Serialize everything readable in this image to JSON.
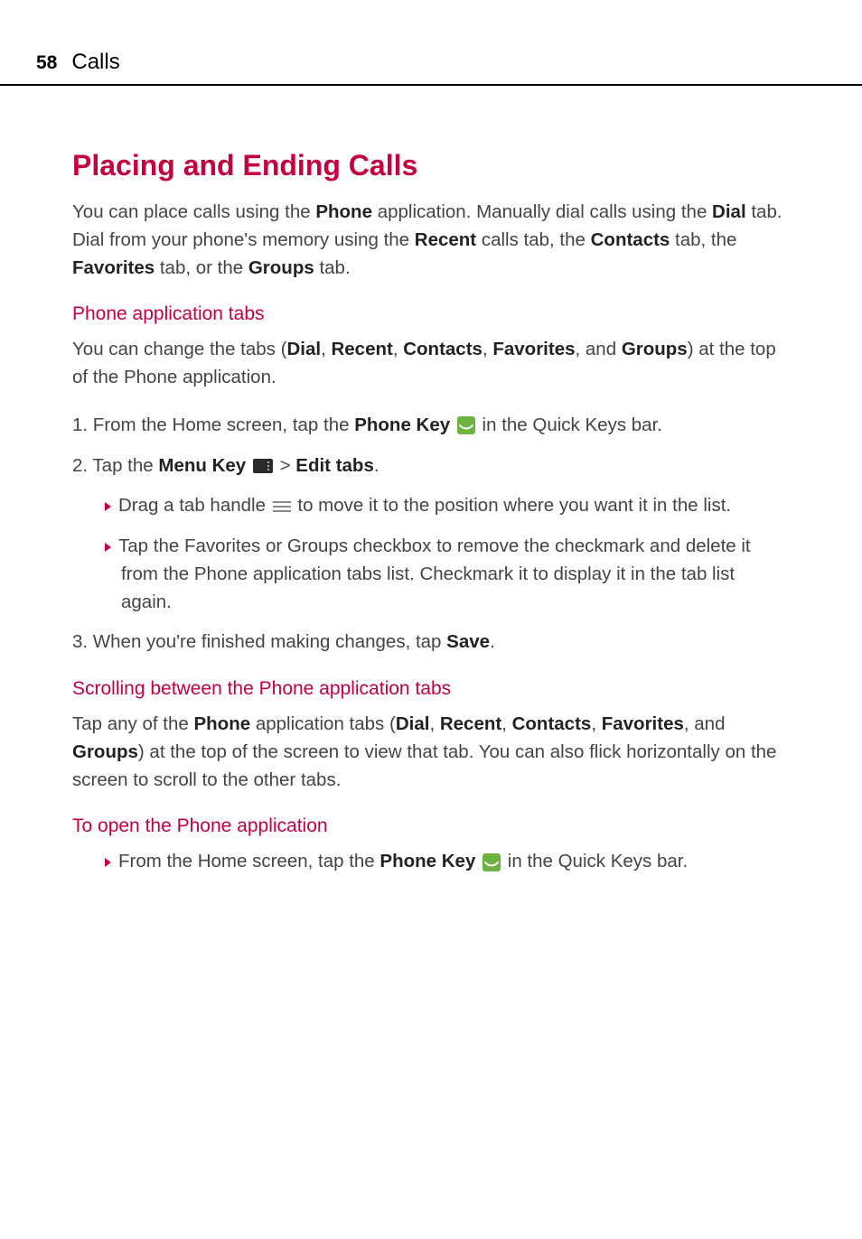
{
  "header": {
    "page_number": "58",
    "section": "Calls"
  },
  "main_heading": "Placing and Ending Calls",
  "intro": {
    "part1": "You can place calls using the ",
    "bold1": "Phone",
    "part2": " application. Manually dial calls using the ",
    "bold2": "Dial",
    "part3": " tab. Dial from your phone's memory using the ",
    "bold3": "Recent",
    "part4": " calls tab, the ",
    "bold4": "Contacts",
    "part5": " tab, the ",
    "bold5": "Favorites",
    "part6": " tab, or the ",
    "bold6": "Groups",
    "part7": " tab."
  },
  "section1": {
    "heading": "Phone application tabs",
    "intro": {
      "part1": "You can change the tabs (",
      "bold1": "Dial",
      "part2": ", ",
      "bold2": "Recent",
      "part3": ", ",
      "bold3": "Contacts",
      "part4": ", ",
      "bold4": "Favorites",
      "part5": ", and ",
      "bold5": "Groups",
      "part6": ") at the top of the Phone application."
    },
    "step1": {
      "num": "1. ",
      "part1": "From the Home screen, tap the ",
      "bold1": "Phone Key",
      "part2": " in the Quick Keys bar."
    },
    "step2": {
      "num": "2. ",
      "part1": "Tap the ",
      "bold1": "Menu Key",
      "part2": " > ",
      "bold2": "Edit tabs",
      "part3": "."
    },
    "sub1": {
      "part1": "Drag a tab handle ",
      "part2": " to move it to the position where you want it in the list."
    },
    "sub2": "Tap the Favorites or Groups checkbox to remove the checkmark and delete it from the Phone application tabs list. Checkmark it to display it in the tab list again.",
    "step3": {
      "num": "3. ",
      "part1": "When you're finished making changes, tap ",
      "bold1": "Save",
      "part2": "."
    }
  },
  "section2": {
    "heading": "Scrolling between the Phone application tabs",
    "body": {
      "part1": "Tap any of the ",
      "bold1": "Phone",
      "part2": " application tabs (",
      "bold2": "Dial",
      "part3": ", ",
      "bold3": "Recent",
      "part4": ", ",
      "bold4": "Contacts",
      "part5": ", ",
      "bold5": "Favorites",
      "part6": ", and ",
      "bold6": "Groups",
      "part7": ") at the top of the screen to view that tab. You can also flick horizontally on the screen to scroll to the other tabs."
    }
  },
  "section3": {
    "heading": "To open the Phone application",
    "bullet": {
      "part1": "From the Home screen, tap the ",
      "bold1": "Phone Key",
      "part2": " in the Quick Keys bar."
    }
  }
}
